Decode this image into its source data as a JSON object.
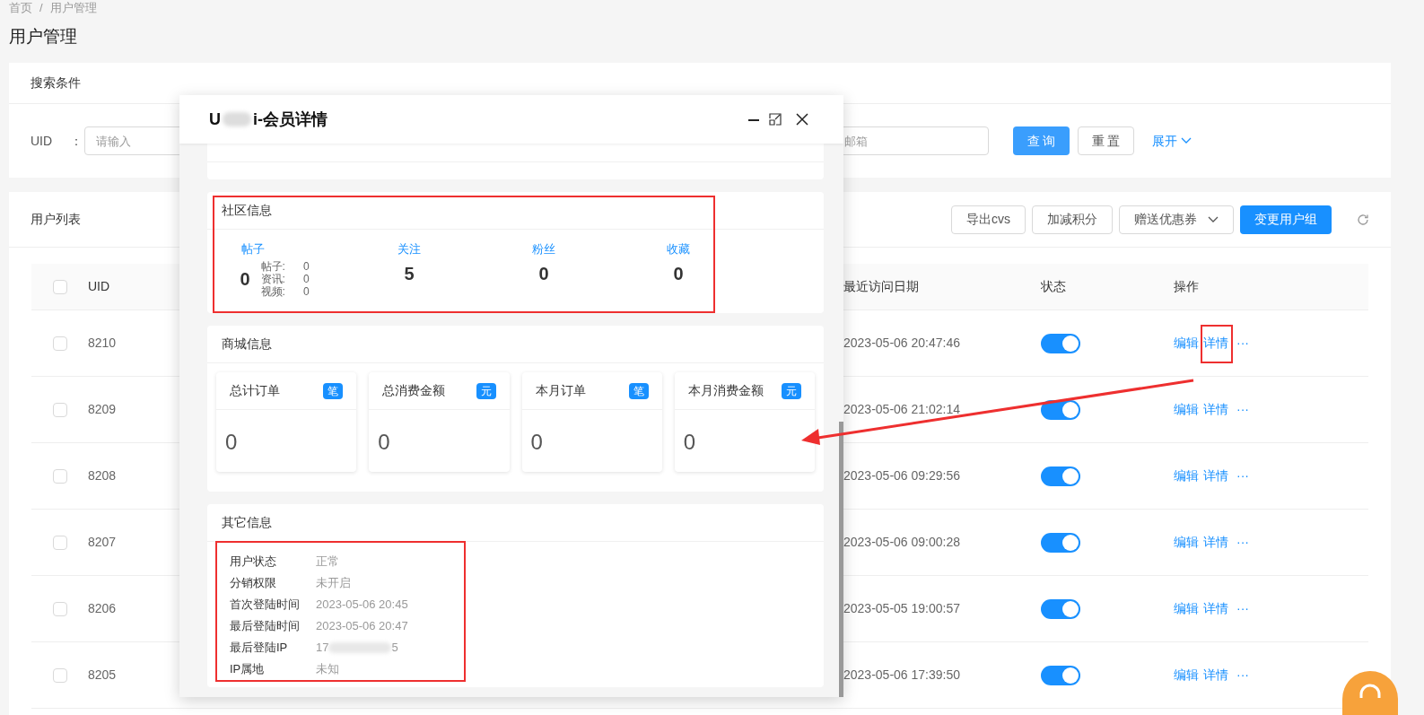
{
  "breadcrumb": [
    "首页",
    "用户管理"
  ],
  "breadcrumb_separator": "/",
  "page_title": "用户管理",
  "search": {
    "title": "搜索条件",
    "uid_label": "UID",
    "uid_colon": "：",
    "uid_placeholder": "请输入",
    "email_placeholder": "邮箱",
    "buttons": [
      "查 询",
      "重 置"
    ],
    "expand": "展开"
  },
  "user_list": {
    "title": "用户列表",
    "buttons": [
      {
        "label": "导出cvs",
        "kind": "plain"
      },
      {
        "label": "加减积分",
        "kind": "plain"
      },
      {
        "label": "赠送优惠券",
        "kind": "dropdown"
      },
      {
        "label": "变更用户组",
        "kind": "primary"
      }
    ],
    "all_checked": false,
    "columns": [
      "UID",
      "最近访问日期",
      "状态",
      "操作"
    ],
    "rows": [
      {
        "uid": "8210",
        "checked": false,
        "date": "2023-05-06 20:47:46",
        "on": true,
        "actions": [
          "编辑",
          "详情",
          "···"
        ]
      },
      {
        "uid": "8209",
        "checked": false,
        "date": "2023-05-06 21:02:14",
        "on": true,
        "actions": [
          "编辑",
          "详情",
          "···"
        ]
      },
      {
        "uid": "8208",
        "checked": false,
        "date": "2023-05-06 09:29:56",
        "on": true,
        "actions": [
          "编辑",
          "详情",
          "···"
        ]
      },
      {
        "uid": "8207",
        "checked": false,
        "date": "2023-05-06 09:00:28",
        "on": true,
        "actions": [
          "编辑",
          "详情",
          "···"
        ]
      },
      {
        "uid": "8206",
        "checked": false,
        "date": "2023-05-05 19:00:57",
        "on": true,
        "actions": [
          "编辑",
          "详情",
          "···"
        ]
      },
      {
        "uid": "8205",
        "checked": false,
        "date": "2023-05-06 17:39:50",
        "on": true,
        "actions": [
          "编辑",
          "详情",
          "···"
        ]
      }
    ]
  },
  "modal": {
    "title_start": "U",
    "title_end": "i-会员详情",
    "community": {
      "title": "社区信息",
      "stats": [
        {
          "label": "帖子",
          "value": "0",
          "breakdown": [
            {
              "label": "帖子:",
              "value": "0"
            },
            {
              "label": "资讯:",
              "value": "0"
            },
            {
              "label": "视频:",
              "value": "0"
            }
          ]
        },
        {
          "label": "关注",
          "value": "5"
        },
        {
          "label": "粉丝",
          "value": "0"
        },
        {
          "label": "收藏",
          "value": "0"
        }
      ]
    },
    "shop": {
      "title": "商城信息",
      "stats": [
        {
          "label": "总计订单",
          "unit": "笔",
          "value": "0"
        },
        {
          "label": "总消费金额",
          "unit": "元",
          "value": "0"
        },
        {
          "label": "本月订单",
          "unit": "笔",
          "value": "0"
        },
        {
          "label": "本月消费金额",
          "unit": "元",
          "value": "0"
        }
      ]
    },
    "other": {
      "title": "其它信息",
      "rows": [
        {
          "label": "用户状态",
          "value": "正常"
        },
        {
          "label": "分销权限",
          "value": "未开启"
        },
        {
          "label": "首次登陆时间",
          "value": "2023-05-06 20:45"
        },
        {
          "label": "最后登陆时间",
          "value": "2023-05-06 20:47"
        },
        {
          "label": "最后登陆IP",
          "value": "17",
          "value_end": "5",
          "blurred": true
        },
        {
          "label": "IP属地",
          "value": "未知"
        }
      ]
    }
  }
}
